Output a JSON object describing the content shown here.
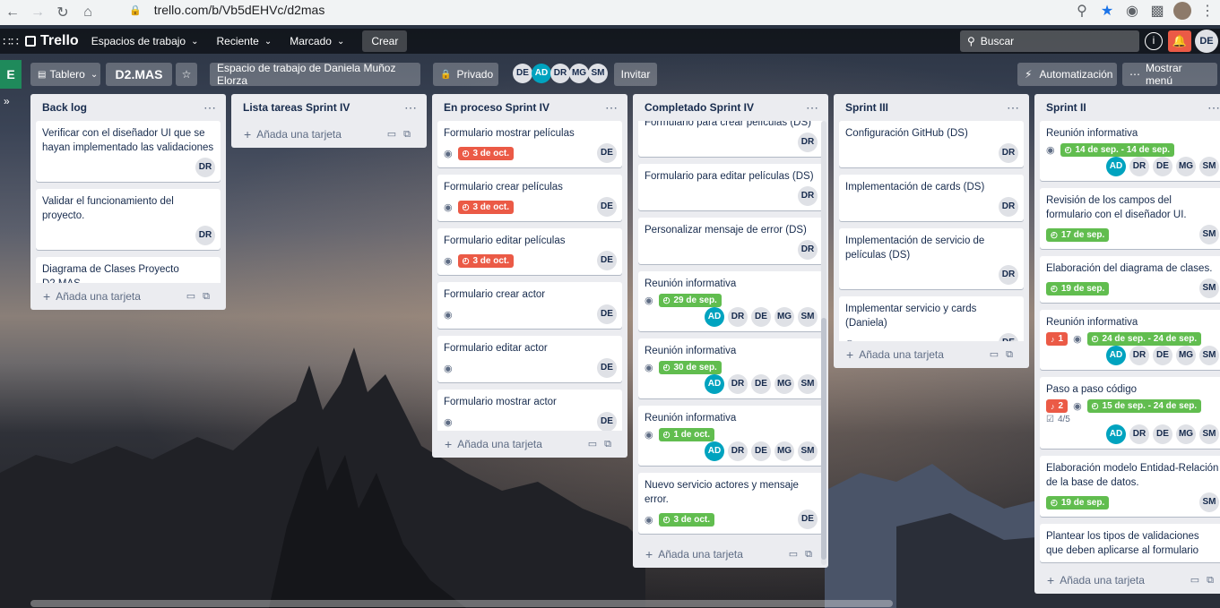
{
  "browser": {
    "url": "trello.com/b/Vb5dEHVc/d2mas",
    "profile_initials": "DE"
  },
  "header": {
    "logo": "Trello",
    "menus": [
      "Espacios de trabajo",
      "Reciente",
      "Marcado"
    ],
    "create": "Crear",
    "search_placeholder": "Buscar",
    "info": "i",
    "avatar": "DE"
  },
  "board": {
    "workspace_tile": "E",
    "view_label": "Tablero",
    "name": "D2.MAS",
    "workspace": "Espacio de trabajo de Daniela Muñoz Elorza",
    "visibility": "Privado",
    "members": [
      "DE",
      "AD",
      "DR",
      "MG",
      "SM"
    ],
    "invite": "Invitar",
    "automation": "Automatización",
    "menu": "Mostrar menú"
  },
  "add_card_label": "Añada una tarjeta",
  "lists": [
    {
      "title": "Back log",
      "cards": [
        {
          "title": "Verificar con el diseñador UI que se hayan implementado las validaciones",
          "members": [
            "DR"
          ]
        },
        {
          "title": "Validar el funcionamiento del proyecto.",
          "members": [
            "DR"
          ]
        },
        {
          "title": "Diagrama de Clases Proyecto D2.MAS",
          "members": []
        }
      ]
    },
    {
      "title": "Lista tareas Sprint IV",
      "cards": []
    },
    {
      "title": "En proceso Sprint IV",
      "cards": [
        {
          "title": "Formulario mostrar películas",
          "watch": true,
          "date": "3 de oct.",
          "date_color": "red",
          "members": [
            "DE"
          ]
        },
        {
          "title": "Formulario crear películas",
          "watch": true,
          "date": "3 de oct.",
          "date_color": "red",
          "members": [
            "DE"
          ]
        },
        {
          "title": "Formulario editar películas",
          "watch": true,
          "date": "3 de oct.",
          "date_color": "red",
          "members": [
            "DE"
          ]
        },
        {
          "title": "Formulario crear actor",
          "watch": true,
          "members": [
            "DE"
          ]
        },
        {
          "title": "Formulario editar actor",
          "watch": true,
          "members": [
            "DE"
          ]
        },
        {
          "title": "Formulario mostrar actor",
          "watch": true,
          "members": [
            "DE"
          ]
        }
      ]
    },
    {
      "title": "Completado Sprint IV",
      "cards": [
        {
          "title": "Formulario para crear películas (DS)",
          "members": [
            "DR"
          ]
        },
        {
          "title": "Formulario para editar películas (DS)",
          "members": [
            "DR"
          ]
        },
        {
          "title": "Personalizar mensaje de error (DS)",
          "members": [
            "DR"
          ]
        },
        {
          "title": "Reunión informativa",
          "watch": true,
          "date": "29 de sep.",
          "date_color": "green",
          "members": [
            "AD",
            "DR",
            "DE",
            "MG",
            "SM"
          ]
        },
        {
          "title": "Reunión informativa",
          "watch": true,
          "date": "30 de sep.",
          "date_color": "green",
          "members": [
            "AD",
            "DR",
            "DE",
            "MG",
            "SM"
          ]
        },
        {
          "title": "Reunión informativa",
          "watch": true,
          "date": "1 de oct.",
          "date_color": "green",
          "members": [
            "AD",
            "DR",
            "DE",
            "MG",
            "SM"
          ]
        },
        {
          "title": "Nuevo servicio actores y mensaje error.",
          "watch": true,
          "date": "3 de oct.",
          "date_color": "green",
          "members": [
            "DE"
          ]
        }
      ]
    },
    {
      "title": "Sprint III",
      "cards": [
        {
          "title": "Configuración GitHub (DS)",
          "members": [
            "DR"
          ]
        },
        {
          "title": "Implementación de cards (DS)",
          "members": [
            "DR"
          ]
        },
        {
          "title": "Implementación de servicio de películas (DS)",
          "members": [
            "DR"
          ]
        },
        {
          "title": "Implementar servicio y cards (Daniela)",
          "watch": true,
          "members": [
            "DE"
          ]
        }
      ]
    },
    {
      "title": "Sprint II",
      "cards": [
        {
          "title": "Reunión informativa",
          "watch": true,
          "date": "14 de sep. - 14 de sep.",
          "date_color": "green",
          "members": [
            "AD",
            "DR",
            "DE",
            "MG",
            "SM"
          ]
        },
        {
          "title": "Revisión de los campos del formulario con el diseñador UI.",
          "date": "17 de sep.",
          "date_color": "green",
          "members": [
            "SM"
          ]
        },
        {
          "title": "Elaboración del diagrama de clases.",
          "date": "19 de sep.",
          "date_color": "green",
          "members": [
            "SM"
          ]
        },
        {
          "title": "Reunión informativa",
          "notify": "1",
          "watch": true,
          "date": "24 de sep. - 24 de sep.",
          "date_color": "green",
          "members": [
            "AD",
            "DR",
            "DE",
            "MG",
            "SM"
          ]
        },
        {
          "title": "Paso a paso código",
          "notify": "2",
          "watch": true,
          "date": "15 de sep. - 24 de sep.",
          "date_color": "green",
          "checklist": "4/5",
          "members": [
            "AD",
            "DR",
            "DE",
            "MG",
            "SM"
          ]
        },
        {
          "title": "Elaboración modelo Entidad-Relación de la base de datos.",
          "date": "19 de sep.",
          "date_color": "green",
          "members": [
            "SM"
          ]
        },
        {
          "title": "Plantear los tipos de validaciones que deben aplicarse al formulario",
          "members": []
        }
      ]
    }
  ]
}
